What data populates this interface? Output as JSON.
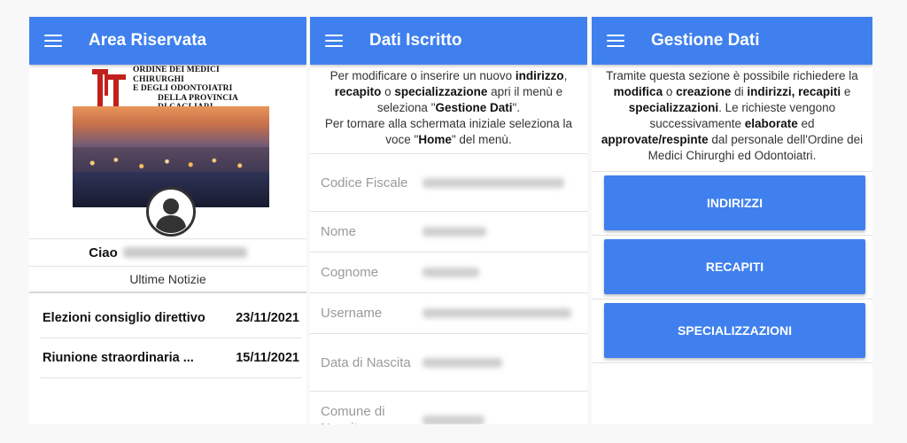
{
  "screen1": {
    "title": "Area Riservata",
    "org_lines": [
      "ORDINE DEI MEDICI CHIRURGHI",
      "E DEGLI ODONTOIATRI",
      "DELLA PROVINCIA",
      "DI CAGLIARI"
    ],
    "greeting": "Ciao",
    "news_heading": "Ultime Notizie",
    "news": [
      {
        "title": "Elezioni consiglio direttivo",
        "date": "23/11/2021"
      },
      {
        "title": "Riunione straordinaria ...",
        "date": "15/11/2021"
      }
    ]
  },
  "screen2": {
    "title": "Dati Iscritto",
    "intro": {
      "p1": "Per modificare o inserire un nuovo ",
      "b1": "indirizzo",
      "p2": ", ",
      "b2": "recapito",
      "p3": " o ",
      "b3": "specializzazione",
      "p4": " apri il menù e seleziona \"",
      "b4": "Gestione Dati",
      "p5": "\".",
      "p6": "Per tornare alla schermata iniziale seleziona la voce \"",
      "b5": "Home",
      "p7": "\" del menù."
    },
    "fields": [
      {
        "label": "Codice Fiscale"
      },
      {
        "label": "Nome"
      },
      {
        "label": "Cognome"
      },
      {
        "label": "Username"
      },
      {
        "label": "Data di Nascita"
      },
      {
        "label": "Comune di Nascita"
      }
    ]
  },
  "screen3": {
    "title": "Gestione Dati",
    "intro": {
      "p1": "Tramite questa sezione è possibile richiedere la ",
      "b1": "modifica",
      "p2": " o ",
      "b2": "creazione",
      "p3": " di ",
      "b3": "indirizzi, recapiti",
      "p4": " e ",
      "b4": "specializzazioni",
      "p5": ". Le richieste vengono successivamente ",
      "b5": "elaborate",
      "p6": " ed ",
      "b6": "approvate/respinte",
      "p7": " dal personale dell'Ordine dei Medici Chirurghi ed Odontoiatri."
    },
    "buttons": [
      "INDIRIZZI",
      "RECAPITI",
      "SPECIALIZZAZIONI"
    ]
  },
  "colors": {
    "accent": "#3f80ee",
    "logo_red": "#c0201c"
  },
  "icons": [
    "menu-icon",
    "account-circle-icon",
    "organization-logo-icon"
  ]
}
